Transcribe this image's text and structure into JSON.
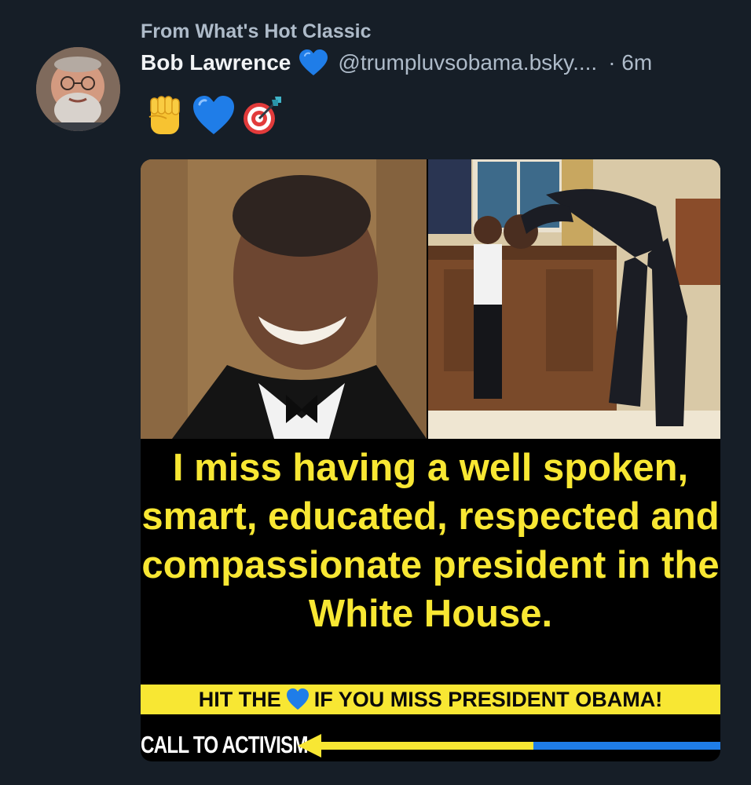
{
  "feed": {
    "context": "From What's Hot Classic"
  },
  "post": {
    "author": {
      "display_name": "Bob Lawrence",
      "name_badge_icon": "blue-heart-icon",
      "handle": "@trumpluvsobama.bsky....",
      "avatar_icon": "avatar-photo"
    },
    "timestamp": "· 6m",
    "emojis": [
      "raised-fist-icon",
      "blue-heart-icon",
      "direct-hit-icon"
    ],
    "image": {
      "caption": "I miss having a well spoken, smart, educated, respected and compassionate president in the White House.",
      "cta_before": "HIT THE",
      "cta_after": "IF YOU MISS PRESIDENT OBAMA!",
      "activism_label": "CALL TO ACTIVISM"
    }
  },
  "colors": {
    "background": "#161e27",
    "primary_text": "#f1f3f5",
    "secondary_text": "#aebbc9",
    "meme_yellow": "#f8e733",
    "heart_blue": "#1f7de8"
  }
}
